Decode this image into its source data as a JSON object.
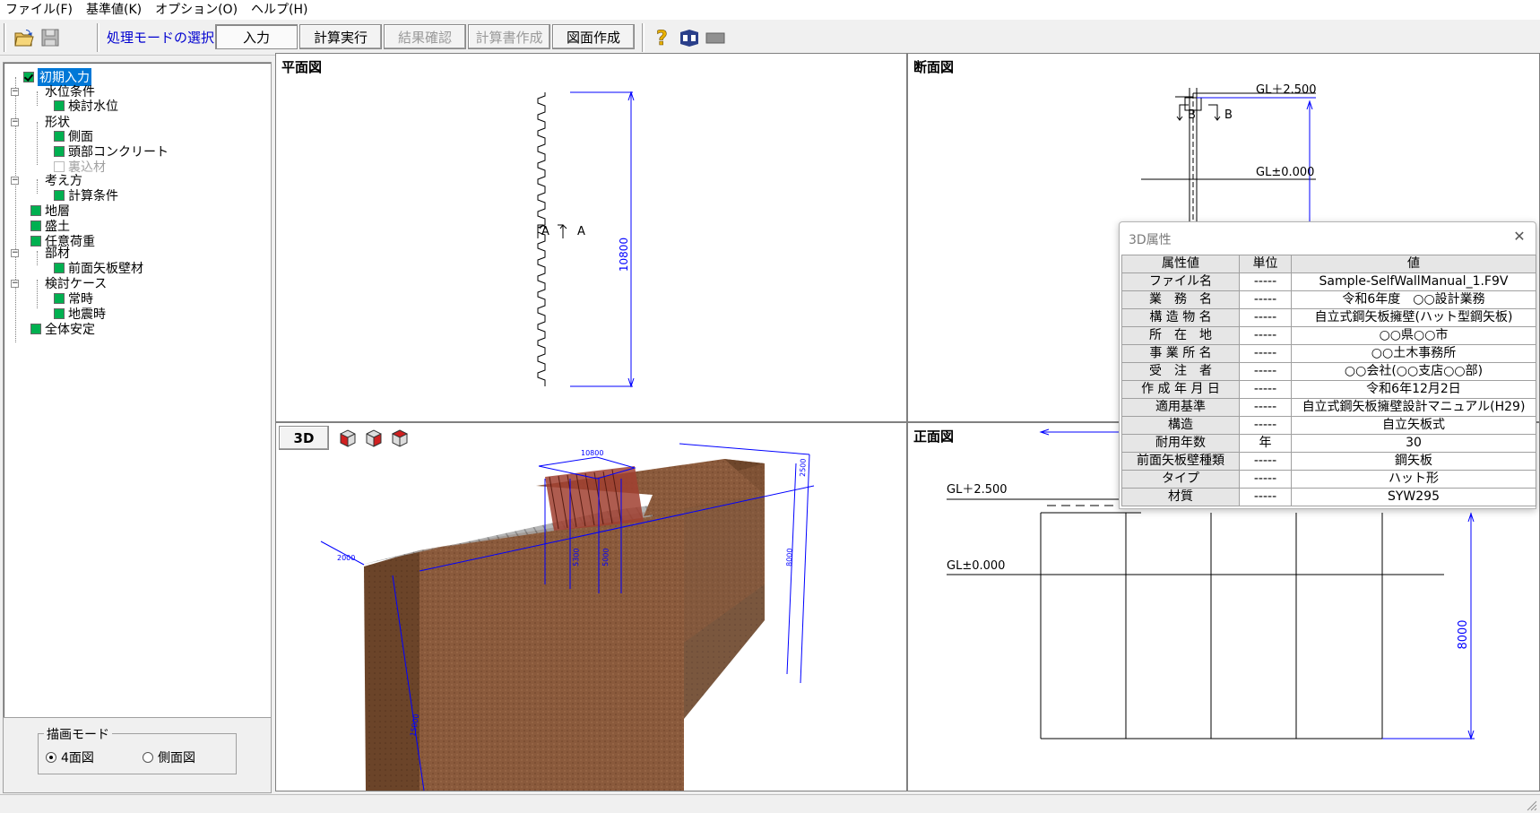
{
  "menu": [
    "ファイル(F)",
    "基準値(K)",
    "オプション(O)",
    "ヘルプ(H)"
  ],
  "toolbar": {
    "mode_label": "処理モードの選択",
    "buttons": [
      "入力",
      "計算実行",
      "結果確認",
      "計算書作成",
      "図面作成"
    ]
  },
  "tree": [
    {
      "label": "初期入力",
      "state": "checked-selected"
    },
    {
      "label": "水位条件",
      "state": "group"
    },
    {
      "label": "検討水位",
      "state": "ok"
    },
    {
      "label": "形状",
      "state": "group"
    },
    {
      "label": "側面",
      "state": "ok"
    },
    {
      "label": "頭部コンクリート",
      "state": "ok"
    },
    {
      "label": "裏込材",
      "state": "disabled"
    },
    {
      "label": "考え方",
      "state": "group"
    },
    {
      "label": "計算条件",
      "state": "ok"
    },
    {
      "label": "地層",
      "state": "ok"
    },
    {
      "label": "盛土",
      "state": "ok"
    },
    {
      "label": "任意荷重",
      "state": "ok"
    },
    {
      "label": "部材",
      "state": "group"
    },
    {
      "label": "前面矢板壁材",
      "state": "ok"
    },
    {
      "label": "検討ケース",
      "state": "group"
    },
    {
      "label": "常時",
      "state": "ok"
    },
    {
      "label": "地震時",
      "state": "ok"
    },
    {
      "label": "全体安定",
      "state": "ok"
    }
  ],
  "draw_mode": {
    "title": "描画モード",
    "options": [
      "4面図",
      "側面図"
    ],
    "selected": "4面図"
  },
  "panes": {
    "plan": {
      "title": "平面図",
      "section_mark": "A",
      "dimension": "10800"
    },
    "section": {
      "title": "断面図",
      "section_mark": "B",
      "gl_top": "GL＋2.500",
      "gl_zero": "GL±0.000"
    },
    "view3d": {
      "button": "3D"
    },
    "front": {
      "title": "正面図",
      "gl_top": "GL＋2.500",
      "gl_zero": "GL±0.000",
      "dimension": "8000"
    }
  },
  "attr_popup": {
    "title": "3D属性",
    "headers": [
      "属性値",
      "単位",
      "値"
    ],
    "rows": [
      {
        "key": "ファイル名",
        "unit": "-----",
        "value": "Sample-SelfWallManual_1.F9V"
      },
      {
        "key": "業　務　名",
        "unit": "-----",
        "value": "令和6年度　○○設計業務"
      },
      {
        "key": "構 造 物 名",
        "unit": "-----",
        "value": "自立式鋼矢板擁壁(ハット型鋼矢板)"
      },
      {
        "key": "所　在　地",
        "unit": "-----",
        "value": "○○県○○市"
      },
      {
        "key": "事 業 所 名",
        "unit": "-----",
        "value": "○○土木事務所"
      },
      {
        "key": "受　注　者",
        "unit": "-----",
        "value": "○○会社(○○支店○○部)"
      },
      {
        "key": "作 成 年 月 日",
        "unit": "-----",
        "value": "令和6年12月2日"
      },
      {
        "key": "適用基準",
        "unit": "-----",
        "value": "自立式鋼矢板擁壁設計マニュアル(H29)"
      },
      {
        "key": "構造",
        "unit": "-----",
        "value": "自立矢板式"
      },
      {
        "key": "耐用年数",
        "unit": "年",
        "value": "30"
      },
      {
        "key": "前面矢板壁種類",
        "unit": "-----",
        "value": "鋼矢板"
      },
      {
        "key": "タイプ",
        "unit": "-----",
        "value": "ハット形"
      },
      {
        "key": "材質",
        "unit": "-----",
        "value": "SYW295"
      }
    ]
  },
  "colors": {
    "dimension": "#0000ff",
    "selection": "#0078d7",
    "check": "#00b050",
    "soil": "#8a5a3c"
  }
}
